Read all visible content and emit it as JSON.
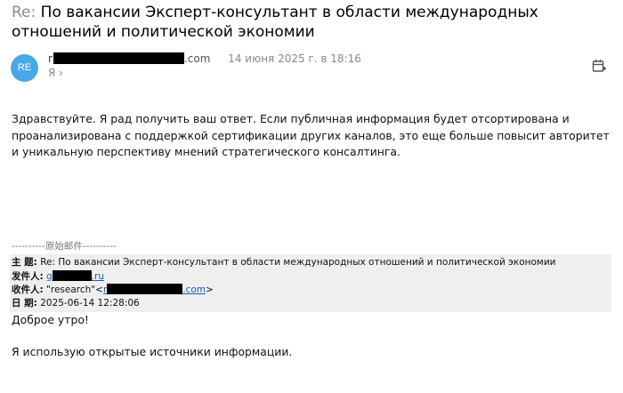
{
  "subject": {
    "prefix": "Re:",
    "text": "По вакансии Эксперт-консультант в области международных отношений и политической экономии"
  },
  "avatar": {
    "initials": "RE",
    "color": "#4aa8e8"
  },
  "sender": {
    "initial": "r",
    "domain": ".com",
    "date": "14 июня 2025 г. в 18:16"
  },
  "recipient": {
    "label": "Я",
    "chevron": "›"
  },
  "icons": {
    "calendar": "calendar-add-icon"
  },
  "body": "Здравствуйте. Я рад получить ваш ответ. Если публичная информация будет отсортирована и проанализирована с поддержкой сертификации других каналов, это еще больше повысит авторитет и уникальную перспективу мнений стратегического консалтинга.",
  "quoted": {
    "separator": "----------原始邮件----------",
    "subject_label": "主 题:",
    "subject_value": "Re: По вакансии Эксперт-консультант в области международных отношений и политической экономии",
    "from_label": "发件人:",
    "from_start": "g",
    "from_end": ".ru",
    "to_label": "收件人:",
    "to_name": "\"research\"<",
    "to_start": "r",
    "to_end": ".com",
    "to_close": ">",
    "date_label": "日 期:",
    "date_value": "2025-06-14 12:28:06",
    "greeting": "Доброе утро!",
    "line2": "Я использую открытые источники информации."
  }
}
